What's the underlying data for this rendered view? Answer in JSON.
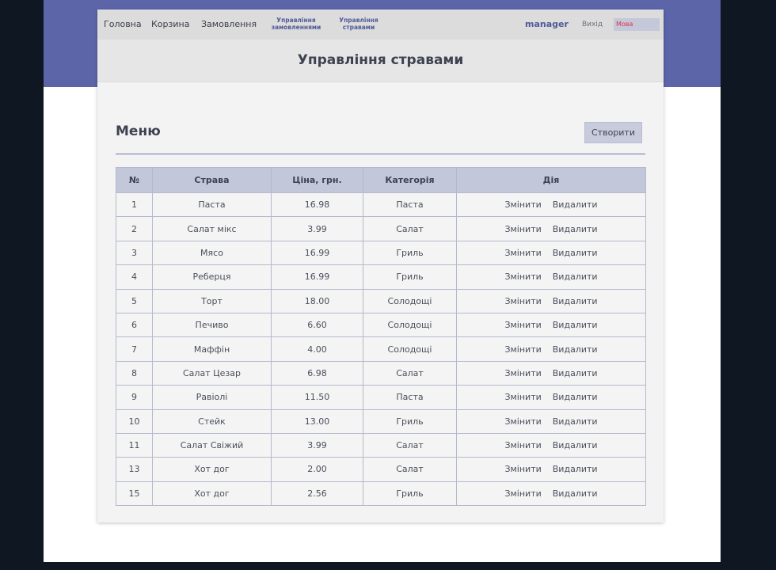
{
  "nav": {
    "home": "Головна",
    "cart": "Корзина",
    "orders": "Замовлення",
    "manage_orders_line1": "Управління",
    "manage_orders_line2": "замовленнями",
    "manage_dishes_line1": "Управління",
    "manage_dishes_line2": "стравами",
    "user": "manager",
    "logout": "Вихід",
    "language": "Мова"
  },
  "header": {
    "title": "Управління стравами"
  },
  "main": {
    "menu_title": "Меню",
    "create_label": "Створити",
    "columns": [
      "№",
      "Страва",
      "Ціна, грн.",
      "Категорія",
      "Дія"
    ],
    "edit_label": "Змінити",
    "delete_label": "Видалити",
    "rows": [
      {
        "id": "1",
        "name": "Паста",
        "price": "16.98",
        "category": "Паста"
      },
      {
        "id": "2",
        "name": "Салат мікс",
        "price": "3.99",
        "category": "Салат"
      },
      {
        "id": "3",
        "name": "Мясо",
        "price": "16.99",
        "category": "Гриль"
      },
      {
        "id": "4",
        "name": "Реберця",
        "price": "16.99",
        "category": "Гриль"
      },
      {
        "id": "5",
        "name": "Торт",
        "price": "18.00",
        "category": "Солодощі"
      },
      {
        "id": "6",
        "name": "Печиво",
        "price": "6.60",
        "category": "Солодощі"
      },
      {
        "id": "7",
        "name": "Маффін",
        "price": "4.00",
        "category": "Солодощі"
      },
      {
        "id": "8",
        "name": "Салат Цезар",
        "price": "6.98",
        "category": "Салат"
      },
      {
        "id": "9",
        "name": "Равіолі",
        "price": "11.50",
        "category": "Паста"
      },
      {
        "id": "10",
        "name": "Стейк",
        "price": "13.00",
        "category": "Гриль"
      },
      {
        "id": "11",
        "name": "Салат Свіжий",
        "price": "3.99",
        "category": "Салат"
      },
      {
        "id": "13",
        "name": "Хот дог",
        "price": "2.00",
        "category": "Салат"
      },
      {
        "id": "15",
        "name": "Хот дог",
        "price": "2.56",
        "category": "Гриль"
      }
    ]
  },
  "colors": {
    "accent": "#5b65a8",
    "header_cell": "#c2c7da",
    "language_text": "#e0304a"
  }
}
